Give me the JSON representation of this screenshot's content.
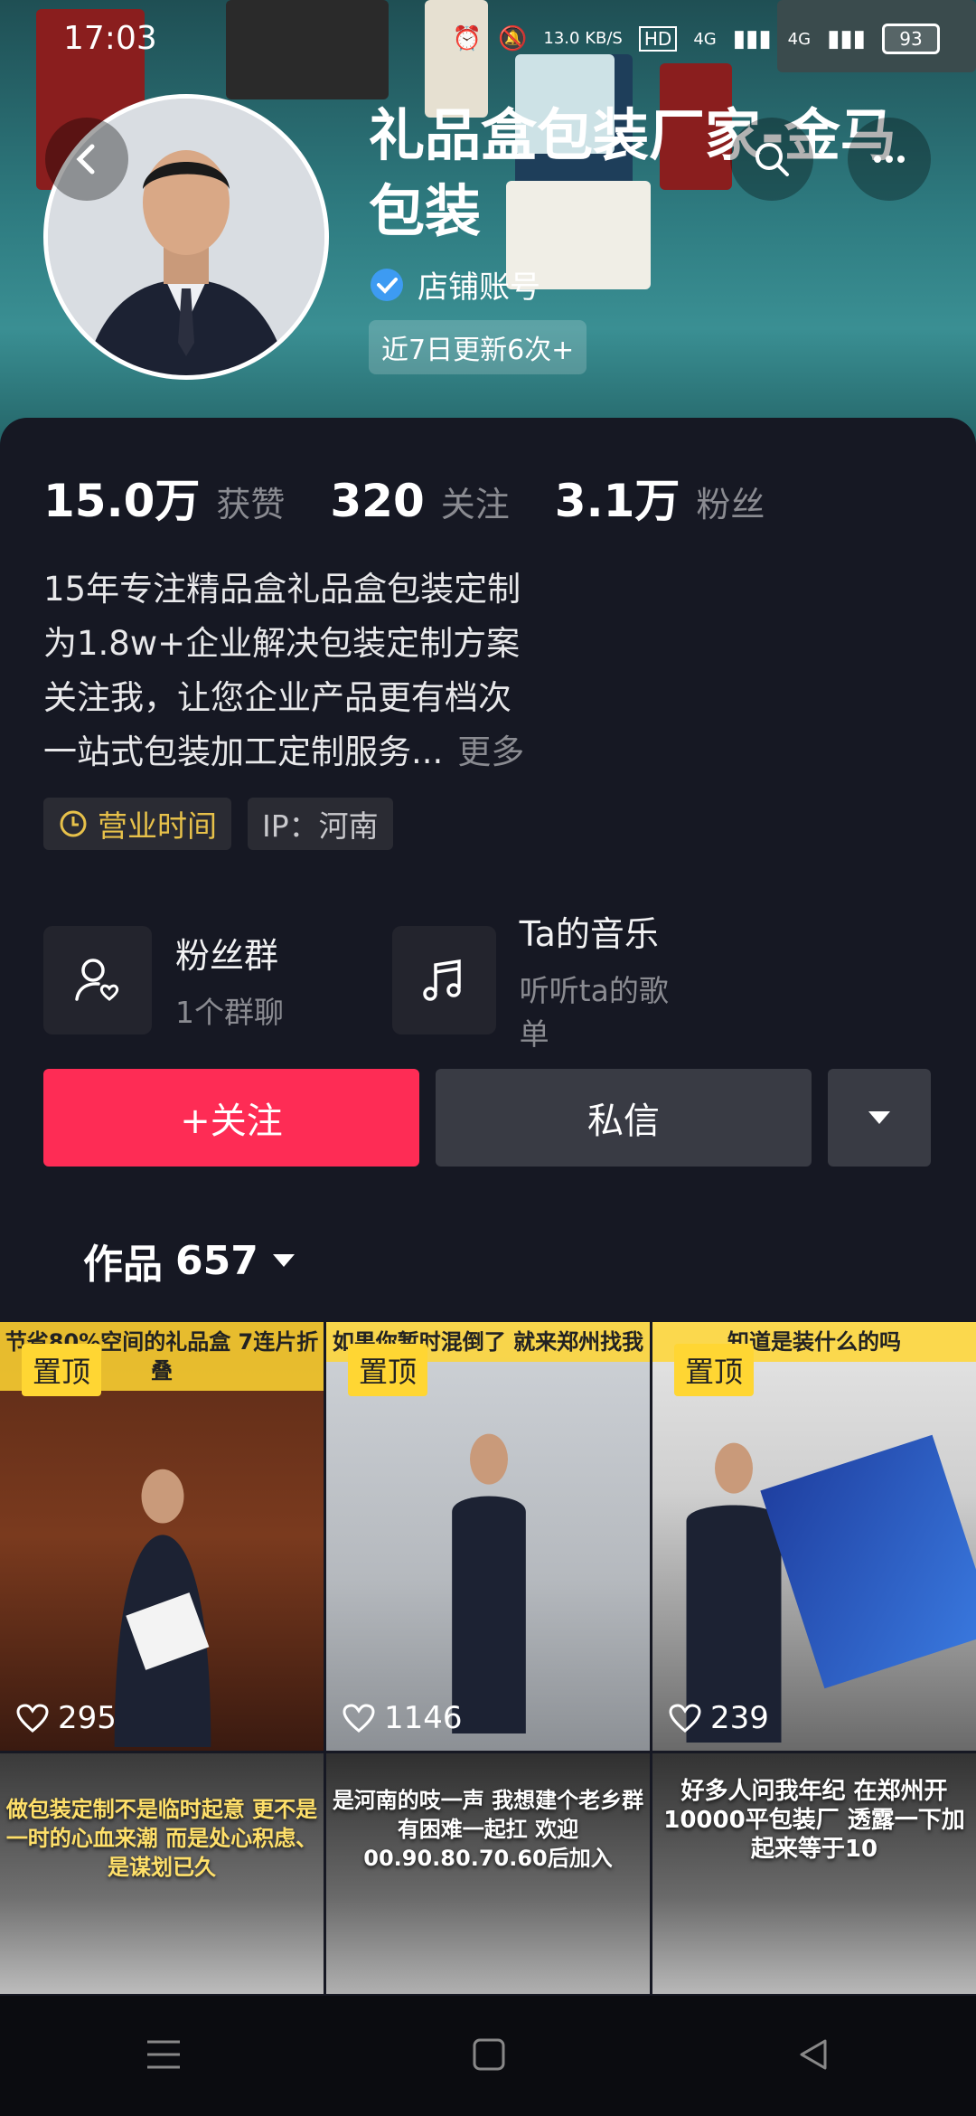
{
  "status_bar": {
    "time": "17:03",
    "network": "13.0 KB/S",
    "hd": "HD",
    "signal1": "4G",
    "signal2": "4G",
    "battery": "93"
  },
  "header": {
    "title": "礼品盒包装厂家-金马包装",
    "verified_label": "店铺账号",
    "update_tag": "近7日更新6次+"
  },
  "stats": [
    {
      "num": "15.0万",
      "label": "获赞"
    },
    {
      "num": "320",
      "label": "关注"
    },
    {
      "num": "3.1万",
      "label": "粉丝"
    }
  ],
  "bio": {
    "lines": [
      "15年专注精品盒礼品盒包装定制",
      "为1.8w+企业解决包装定制方案",
      "关注我，让您企业产品更有档次",
      "一站式包装加工定制服务..."
    ],
    "more": "更多"
  },
  "tags": {
    "hours": "营业时间",
    "ip": "IP：河南"
  },
  "features": [
    {
      "title": "粉丝群",
      "sub": "1个群聊"
    },
    {
      "title": "Ta的音乐",
      "sub": "听听ta的歌单"
    }
  ],
  "buttons": {
    "follow": "+关注",
    "message": "私信"
  },
  "works": {
    "label": "作品",
    "count": "657"
  },
  "videos": [
    {
      "pin": "置顶",
      "caption": "节省80%空间的礼品盒 7连片折叠",
      "likes": "295"
    },
    {
      "pin": "置顶",
      "caption": "如果你暂时混倒了 就来郑州找我",
      "likes": "1146"
    },
    {
      "pin": "置顶",
      "caption": "知道是装什么的吗",
      "likes": "239"
    },
    {
      "caption": "做包装定制不是临时起意 更不是一时的心血来潮 而是处心积虑、是谋划已久"
    },
    {
      "caption": "是河南的吱一声 我想建个老乡群 有困难一起扛 欢迎00.90.80.70.60后加入"
    },
    {
      "caption": "好多人问我年纪 在郑州开10000平包装厂 透露一下加起来等于10"
    }
  ],
  "colors": {
    "accent": "#fe2c55",
    "pin": "#ffd633",
    "bg": "#161823"
  }
}
